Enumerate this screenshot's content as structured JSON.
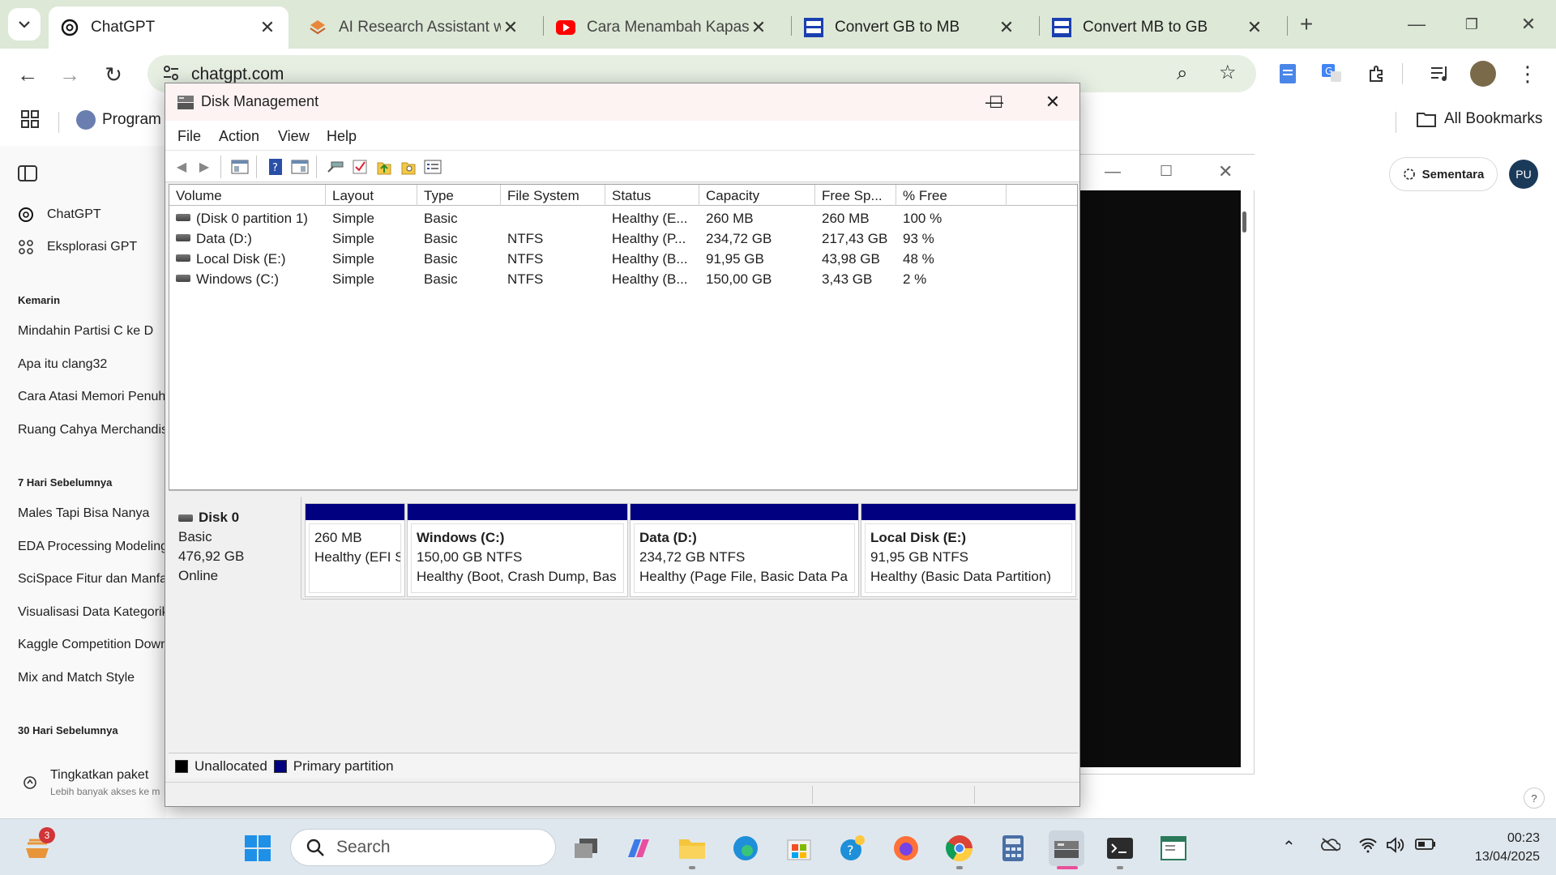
{
  "browser": {
    "tabs": [
      {
        "title": "ChatGPT",
        "active": true,
        "icon": "chatgpt-icon"
      },
      {
        "title": "AI Research Assistant wit",
        "icon": "layers-icon"
      },
      {
        "title": "Cara Menambah Kapasita",
        "icon": "youtube-icon"
      },
      {
        "title": "Convert GB to MB",
        "icon": "dans-tools-icon"
      },
      {
        "title": "Convert MB to GB",
        "icon": "dans-tools-icon"
      }
    ],
    "url": "chatgpt.com",
    "bookmarks": {
      "program": "Program",
      "all": "All Bookmarks"
    }
  },
  "chatgpt": {
    "nav": {
      "chatgpt": "ChatGPT",
      "explore": "Eksplorasi GPT"
    },
    "sections": [
      {
        "heading": "Kemarin",
        "items": [
          "Mindahin Partisi C ke D",
          "Apa itu clang32",
          "Cara Atasi Memori Penuh",
          "Ruang Cahya Merchandise"
        ]
      },
      {
        "heading": "7 Hari Sebelumnya",
        "items": [
          "Males Tapi Bisa Nanya",
          "EDA Processing Modeling",
          "SciSpace Fitur dan Manfaat",
          "Visualisasi Data Kategorik",
          "Kaggle Competition Down",
          "Mix and Match Style"
        ]
      },
      {
        "heading": "30 Hari Sebelumnya",
        "items": []
      }
    ],
    "upgrade": {
      "title": "Tingkatkan paket",
      "subtitle": "Lebih banyak akses ke m"
    },
    "temporary": "Sementara",
    "avatar": "PU",
    "help": "?"
  },
  "disk_management": {
    "title": "Disk Management",
    "menu": [
      "File",
      "Action",
      "View",
      "Help"
    ],
    "columns": [
      "Volume",
      "Layout",
      "Type",
      "File System",
      "Status",
      "Capacity",
      "Free Sp...",
      "% Free"
    ],
    "volumes": [
      {
        "volume": "(Disk 0 partition 1)",
        "layout": "Simple",
        "type": "Basic",
        "fs": "",
        "status": "Healthy (E...",
        "capacity": "260 MB",
        "free": "260 MB",
        "pct": "100 %"
      },
      {
        "volume": "Data (D:)",
        "layout": "Simple",
        "type": "Basic",
        "fs": "NTFS",
        "status": "Healthy (P...",
        "capacity": "234,72 GB",
        "free": "217,43 GB",
        "pct": "93 %"
      },
      {
        "volume": "Local Disk (E:)",
        "layout": "Simple",
        "type": "Basic",
        "fs": "NTFS",
        "status": "Healthy (B...",
        "capacity": "91,95 GB",
        "free": "43,98 GB",
        "pct": "48 %"
      },
      {
        "volume": "Windows (C:)",
        "layout": "Simple",
        "type": "Basic",
        "fs": "NTFS",
        "status": "Healthy (B...",
        "capacity": "150,00 GB",
        "free": "3,43 GB",
        "pct": "2 %"
      }
    ],
    "disk": {
      "name": "Disk 0",
      "kind": "Basic",
      "size": "476,92 GB",
      "state": "Online"
    },
    "partitions": [
      {
        "name": "",
        "size": "260 MB",
        "status": "Healthy (EFI S"
      },
      {
        "name": "Windows  (C:)",
        "size": "150,00 GB NTFS",
        "status": "Healthy (Boot, Crash Dump, Bas"
      },
      {
        "name": "Data  (D:)",
        "size": "234,72 GB NTFS",
        "status": "Healthy (Page File, Basic Data Pa"
      },
      {
        "name": "Local Disk  (E:)",
        "size": "91,95 GB NTFS",
        "status": "Healthy (Basic Data Partition)"
      }
    ],
    "legend": {
      "unallocated": "Unallocated",
      "primary": "Primary partition"
    },
    "colors": {
      "primary": "#000080",
      "unallocated": "#000000"
    }
  },
  "taskbar": {
    "search": "Search",
    "badge": "3",
    "time": "00:23",
    "date": "13/04/2025"
  }
}
